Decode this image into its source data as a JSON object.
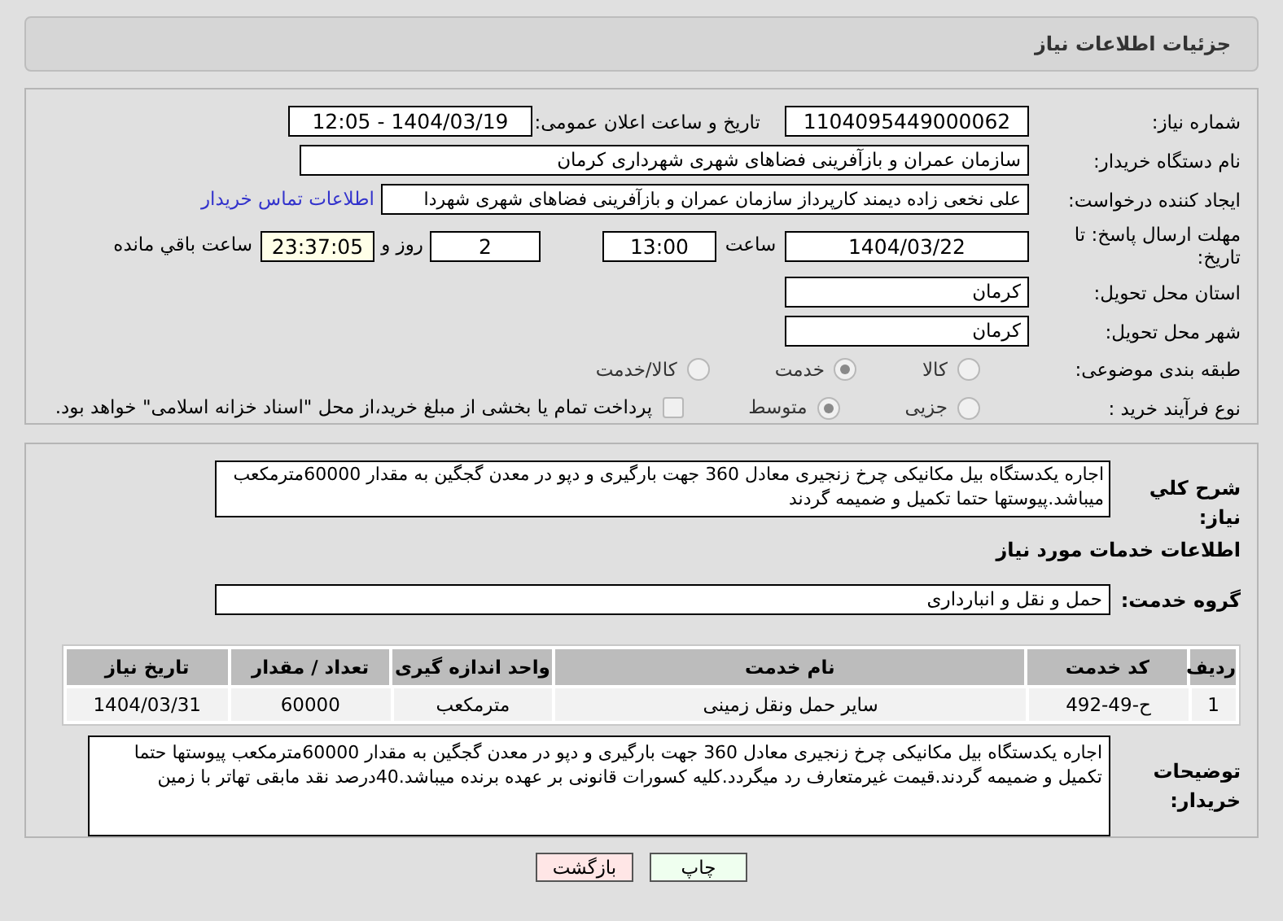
{
  "title": "جزئیات اطلاعات نیاز",
  "need_number": {
    "label": "شماره نیاز:",
    "value": "1104095449000062"
  },
  "announce_datetime": {
    "label": "تاریخ و ساعت اعلان عمومی:",
    "value": "1404/03/19 - 12:05"
  },
  "buyer_org": {
    "label": "نام دستگاه خریدار:",
    "value": "سازمان عمران و بازآفرینی فضاهای شهری شهرداری کرمان"
  },
  "requester": {
    "label": "ایجاد کننده درخواست:",
    "value": "علی نخعی زاده دیمند کارپرداز سازمان عمران و بازآفرینی فضاهای شهری شهردا",
    "link": "اطلاعات تماس خریدار"
  },
  "deadline": {
    "label": "مهلت ارسال پاسخ: تا تاریخ:",
    "date": "1404/03/22",
    "time_label": "ساعت",
    "time": "13:00",
    "days": "2",
    "days_label": "روز و",
    "remaining": "23:37:05",
    "remaining_label": "ساعت باقي مانده"
  },
  "province": {
    "label": "استان محل تحویل:",
    "value": "کرمان"
  },
  "city": {
    "label": "شهر محل تحویل:",
    "value": "کرمان"
  },
  "category": {
    "label": "طبقه بندی موضوعی:",
    "options": [
      {
        "label": "کالا",
        "selected": false
      },
      {
        "label": "خدمت",
        "selected": true
      },
      {
        "label": "کالا/خدمت",
        "selected": false
      }
    ]
  },
  "purchase_type": {
    "label": "نوع فرآیند خرید :",
    "options": [
      {
        "label": "جزیی",
        "selected": false
      },
      {
        "label": "متوسط",
        "selected": true
      }
    ],
    "treasury": {
      "label": "پرداخت تمام یا بخشی از مبلغ خرید،از محل \"اسناد خزانه اسلامی\" خواهد بود.",
      "checked": false
    }
  },
  "summary": {
    "label": "شرح کلي نياز:",
    "value": "اجاره یکدستگاه بیل مکانیکی چرخ زنجیری معادل 360 جهت بارگیری و دپو در معدن گجگین به مقدار 60000مترمکعب میباشد.پیوستها حتما تکمیل و ضمیمه گردند"
  },
  "services_heading": "اطلاعات خدمات مورد نیاز",
  "service_group": {
    "label": "گروه خدمت:",
    "value": "حمل و نقل و انبارداری"
  },
  "table": {
    "columns": [
      "ردیف",
      "کد خدمت",
      "نام خدمت",
      "واحد اندازه گیری",
      "تعداد / مقدار",
      "تاریخ نیاز"
    ],
    "rows": [
      [
        "1",
        "ح-49-492",
        "سایر حمل ونقل زمینی",
        "مترمکعب",
        "60000",
        "1404/03/31"
      ]
    ]
  },
  "buyer_notes": {
    "label": "توضیحات خریدار:",
    "value": "اجاره یکدستگاه بیل مکانیکی چرخ زنجیری معادل 360 جهت بارگیری و دپو در معدن گجگین به مقدار 60000مترمکعب پیوستها حتما تکمیل و ضمیمه گردند.قیمت غیرمتعارف رد میگردد.کلیه کسورات قانونی بر عهده برنده میباشد.40درصد نقد مابقی تهاتر با زمین"
  },
  "buttons": [
    {
      "label": "چاپ",
      "kind": "print"
    },
    {
      "label": "بازگشت",
      "kind": "back"
    }
  ]
}
